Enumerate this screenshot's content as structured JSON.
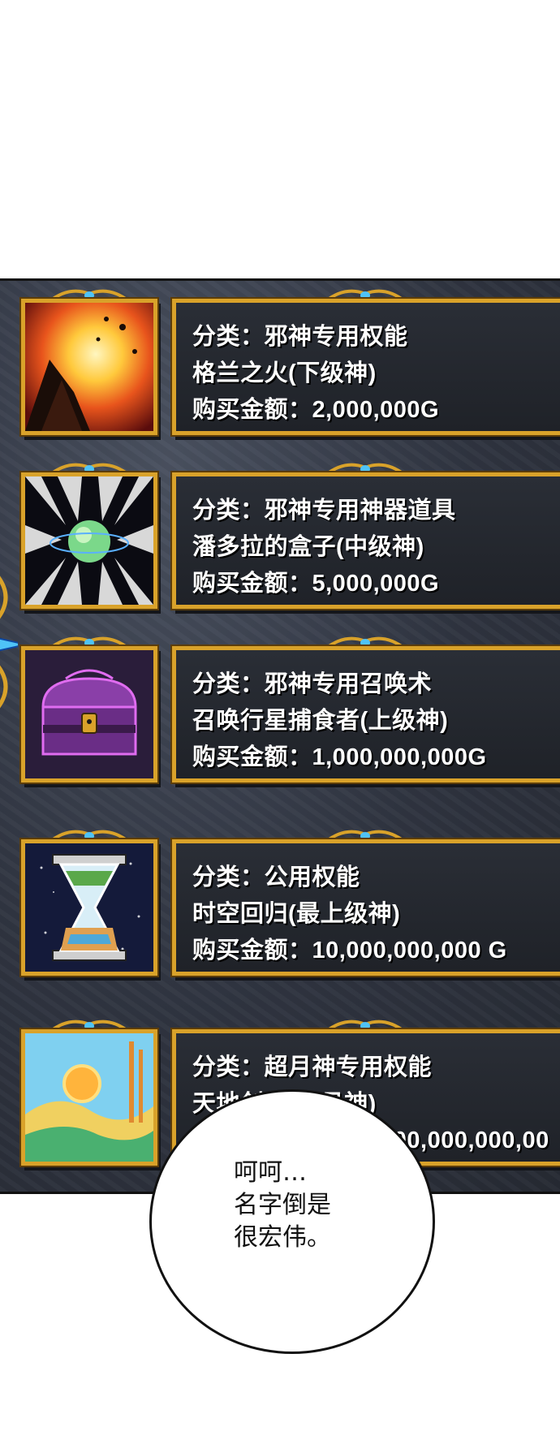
{
  "items": [
    {
      "icon": "fire-eruption-icon",
      "category": "分类：邪神专用权能",
      "name": "格兰之火(下级神)",
      "price": "购买金额：2,000,000G"
    },
    {
      "icon": "planet-box-icon",
      "category": "分类：邪神专用神器道具",
      "name": "潘多拉的盒子(中级神)",
      "price": "购买金额：5,000,000G"
    },
    {
      "icon": "treasure-chest-icon",
      "category": "分类：邪神专用召唤术",
      "name": "召唤行星捕食者(上级神)",
      "price": "购买金额：1,000,000,000G"
    },
    {
      "icon": "hourglass-icon",
      "category": "分类：公用权能",
      "name": "时空回归(最上级神)",
      "price": "购买金额：10,000,000,000 G"
    },
    {
      "icon": "landscape-sun-icon",
      "category": "分类：超月神专用权能",
      "name": "天地创造(超月神)",
      "price": "购买金额：1,000,000,000,000,00"
    }
  ],
  "speech_bubble": {
    "lines": [
      "呵呵…",
      "名字倒是",
      "很宏伟。"
    ]
  },
  "colors": {
    "frame_gold": "#d9a22a",
    "panel_stone": "#2f3440"
  }
}
